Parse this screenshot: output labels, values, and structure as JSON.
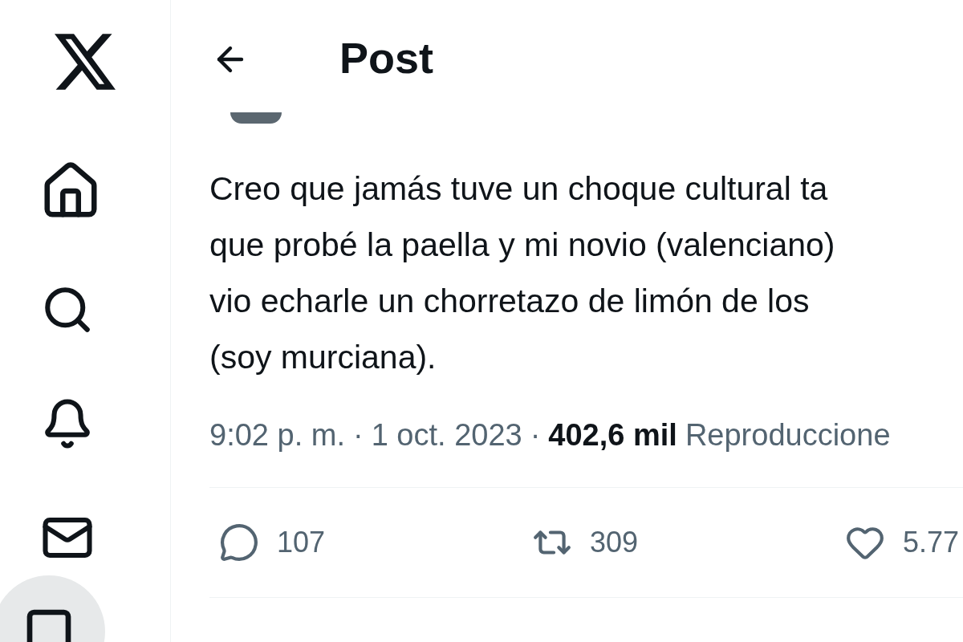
{
  "header": {
    "title": "Post"
  },
  "post": {
    "lines": [
      "Creo que jamás tuve un choque cultural ta",
      "que probé la paella y mi novio (valenciano)",
      "vio echarle un chorretazo de limón de los",
      "(soy murciana)."
    ],
    "time": "9:02 p. m.",
    "separator": "·",
    "date": "1 oct. 2023",
    "views_count": "402,6 mil",
    "views_label": "Reproduccione"
  },
  "actions": [
    {
      "kind": "reply",
      "count": "107"
    },
    {
      "kind": "repost",
      "count": "309"
    },
    {
      "kind": "like",
      "count": "5.77"
    }
  ]
}
